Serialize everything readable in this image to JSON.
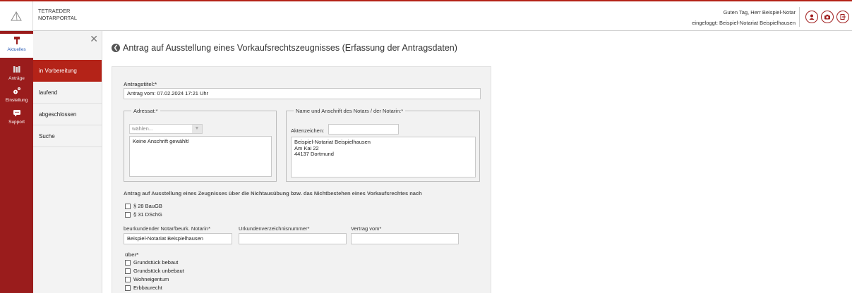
{
  "header": {
    "brand_line1": "TETRAEDER",
    "brand_line2": "NOTARPORTAL",
    "greeting": "Guten Tag, Herr Beispiel-Notar",
    "logged_in": "eingeloggt: Beispiel-Notariat Beispielhausen",
    "icons": [
      "user-icon",
      "camera-icon",
      "exit-icon"
    ]
  },
  "rail": [
    {
      "label": "Aktuelles",
      "icon": "hammer-icon"
    },
    {
      "label": "Anträge",
      "icon": "books-icon"
    },
    {
      "label": "Einstellung",
      "icon": "gears-icon"
    },
    {
      "label": "Support",
      "icon": "chat-icon"
    }
  ],
  "submenu": {
    "items": [
      "in Vorbereitung",
      "laufend",
      "abgeschlossen",
      "Suche"
    ]
  },
  "main": {
    "title": "Antrag auf Ausstellung eines Vorkaufsrechtszeugnisses (Erfassung der Antragsdaten)",
    "antragstitel_label": "Antragstitel:*",
    "antragstitel_value": "Antrag vom: 07.02.2024 17:21 Uhr",
    "adressat": {
      "legend": "Adressat:*",
      "select_placeholder": "wählen...",
      "text": "Keine Anschrift gewählt!"
    },
    "notar": {
      "legend": "Name und Anschrift des Notars / der Notarin:*",
      "aktenzeichen_label": "Aktenzeichen:",
      "aktenzeichen_value": "",
      "address": "Beispiel-Notariat Beispielhausen\nAm Kai 22\n44137 Dortmund"
    },
    "section_heading": "Antrag auf Ausstellung eines Zeugnisses über die Nichtausübung bzw. das Nichtbestehen eines Vorkaufsrechtes nach",
    "paragraphs": [
      "§ 28 BauGB",
      "§ 31 DSchG"
    ],
    "fields": {
      "notar_label": "beurkundender Notar/beurk. Notarin*",
      "notar_value": "Beispiel-Notariat Beispielhausen",
      "urkunden_label": "Urkundenverzeichnisnummer*",
      "urkunden_value": "",
      "vertrag_label": "Vertrag vom*",
      "vertrag_value": ""
    },
    "ueber_label": "über*",
    "ueber_options": [
      "Grundstück bebaut",
      "Grundstück unbebaut",
      "Wohneigentum",
      "Erbbaurecht"
    ]
  },
  "colors": {
    "accent": "#b42318",
    "rail": "#9a1c1c",
    "link": "#2d5fb8"
  }
}
